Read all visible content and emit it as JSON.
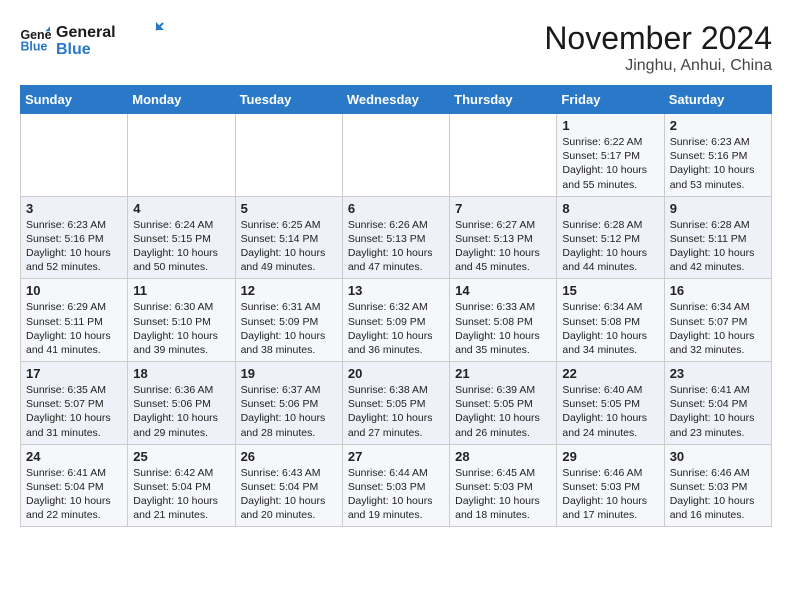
{
  "logo": {
    "line1": "General",
    "line2": "Blue",
    "arrow_color": "#2979c8"
  },
  "title": "November 2024",
  "location": "Jinghu, Anhui, China",
  "days_of_week": [
    "Sunday",
    "Monday",
    "Tuesday",
    "Wednesday",
    "Thursday",
    "Friday",
    "Saturday"
  ],
  "weeks": [
    [
      {
        "day": "",
        "content": ""
      },
      {
        "day": "",
        "content": ""
      },
      {
        "day": "",
        "content": ""
      },
      {
        "day": "",
        "content": ""
      },
      {
        "day": "",
        "content": ""
      },
      {
        "day": "1",
        "content": "Sunrise: 6:22 AM\nSunset: 5:17 PM\nDaylight: 10 hours\nand 55 minutes."
      },
      {
        "day": "2",
        "content": "Sunrise: 6:23 AM\nSunset: 5:16 PM\nDaylight: 10 hours\nand 53 minutes."
      }
    ],
    [
      {
        "day": "3",
        "content": "Sunrise: 6:23 AM\nSunset: 5:16 PM\nDaylight: 10 hours\nand 52 minutes."
      },
      {
        "day": "4",
        "content": "Sunrise: 6:24 AM\nSunset: 5:15 PM\nDaylight: 10 hours\nand 50 minutes."
      },
      {
        "day": "5",
        "content": "Sunrise: 6:25 AM\nSunset: 5:14 PM\nDaylight: 10 hours\nand 49 minutes."
      },
      {
        "day": "6",
        "content": "Sunrise: 6:26 AM\nSunset: 5:13 PM\nDaylight: 10 hours\nand 47 minutes."
      },
      {
        "day": "7",
        "content": "Sunrise: 6:27 AM\nSunset: 5:13 PM\nDaylight: 10 hours\nand 45 minutes."
      },
      {
        "day": "8",
        "content": "Sunrise: 6:28 AM\nSunset: 5:12 PM\nDaylight: 10 hours\nand 44 minutes."
      },
      {
        "day": "9",
        "content": "Sunrise: 6:28 AM\nSunset: 5:11 PM\nDaylight: 10 hours\nand 42 minutes."
      }
    ],
    [
      {
        "day": "10",
        "content": "Sunrise: 6:29 AM\nSunset: 5:11 PM\nDaylight: 10 hours\nand 41 minutes."
      },
      {
        "day": "11",
        "content": "Sunrise: 6:30 AM\nSunset: 5:10 PM\nDaylight: 10 hours\nand 39 minutes."
      },
      {
        "day": "12",
        "content": "Sunrise: 6:31 AM\nSunset: 5:09 PM\nDaylight: 10 hours\nand 38 minutes."
      },
      {
        "day": "13",
        "content": "Sunrise: 6:32 AM\nSunset: 5:09 PM\nDaylight: 10 hours\nand 36 minutes."
      },
      {
        "day": "14",
        "content": "Sunrise: 6:33 AM\nSunset: 5:08 PM\nDaylight: 10 hours\nand 35 minutes."
      },
      {
        "day": "15",
        "content": "Sunrise: 6:34 AM\nSunset: 5:08 PM\nDaylight: 10 hours\nand 34 minutes."
      },
      {
        "day": "16",
        "content": "Sunrise: 6:34 AM\nSunset: 5:07 PM\nDaylight: 10 hours\nand 32 minutes."
      }
    ],
    [
      {
        "day": "17",
        "content": "Sunrise: 6:35 AM\nSunset: 5:07 PM\nDaylight: 10 hours\nand 31 minutes."
      },
      {
        "day": "18",
        "content": "Sunrise: 6:36 AM\nSunset: 5:06 PM\nDaylight: 10 hours\nand 29 minutes."
      },
      {
        "day": "19",
        "content": "Sunrise: 6:37 AM\nSunset: 5:06 PM\nDaylight: 10 hours\nand 28 minutes."
      },
      {
        "day": "20",
        "content": "Sunrise: 6:38 AM\nSunset: 5:05 PM\nDaylight: 10 hours\nand 27 minutes."
      },
      {
        "day": "21",
        "content": "Sunrise: 6:39 AM\nSunset: 5:05 PM\nDaylight: 10 hours\nand 26 minutes."
      },
      {
        "day": "22",
        "content": "Sunrise: 6:40 AM\nSunset: 5:05 PM\nDaylight: 10 hours\nand 24 minutes."
      },
      {
        "day": "23",
        "content": "Sunrise: 6:41 AM\nSunset: 5:04 PM\nDaylight: 10 hours\nand 23 minutes."
      }
    ],
    [
      {
        "day": "24",
        "content": "Sunrise: 6:41 AM\nSunset: 5:04 PM\nDaylight: 10 hours\nand 22 minutes."
      },
      {
        "day": "25",
        "content": "Sunrise: 6:42 AM\nSunset: 5:04 PM\nDaylight: 10 hours\nand 21 minutes."
      },
      {
        "day": "26",
        "content": "Sunrise: 6:43 AM\nSunset: 5:04 PM\nDaylight: 10 hours\nand 20 minutes."
      },
      {
        "day": "27",
        "content": "Sunrise: 6:44 AM\nSunset: 5:03 PM\nDaylight: 10 hours\nand 19 minutes."
      },
      {
        "day": "28",
        "content": "Sunrise: 6:45 AM\nSunset: 5:03 PM\nDaylight: 10 hours\nand 18 minutes."
      },
      {
        "day": "29",
        "content": "Sunrise: 6:46 AM\nSunset: 5:03 PM\nDaylight: 10 hours\nand 17 minutes."
      },
      {
        "day": "30",
        "content": "Sunrise: 6:46 AM\nSunset: 5:03 PM\nDaylight: 10 hours\nand 16 minutes."
      }
    ]
  ]
}
